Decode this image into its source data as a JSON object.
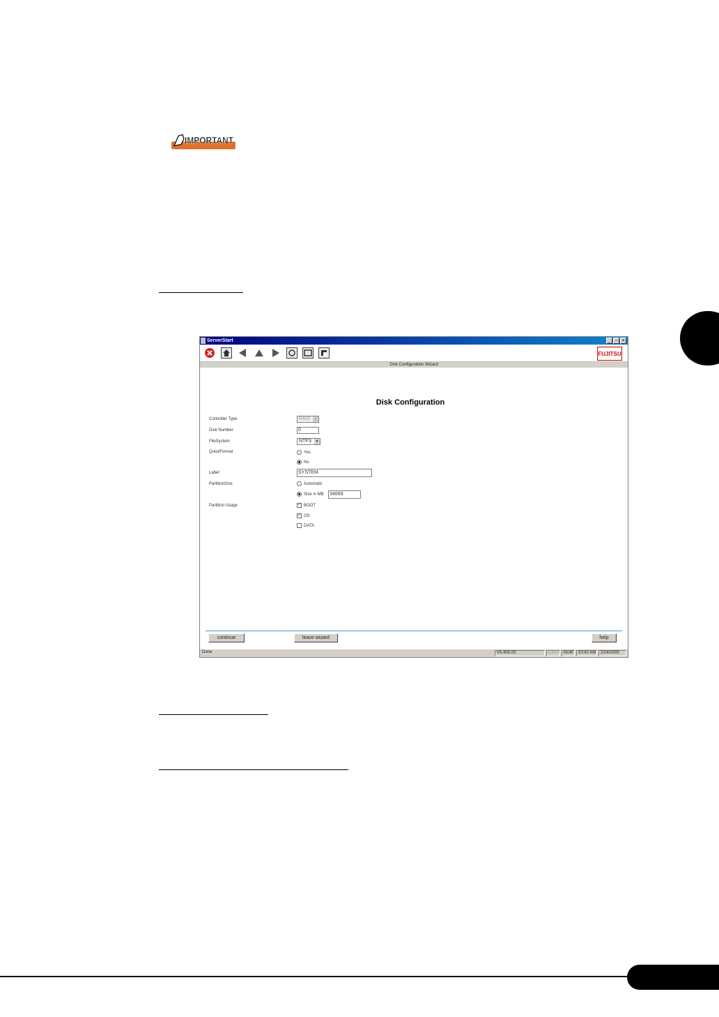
{
  "badge": {
    "text": "IMPORTANT"
  },
  "window": {
    "title": "ServerStart",
    "controls": {
      "minimize": "_",
      "maximize": "▫",
      "close": "×"
    },
    "logo": "FUJITSU",
    "wizard_bar": "Disk Configuration Wizard",
    "heading": "Disk Configuration",
    "form": {
      "controller_type": {
        "label": "Controller Type",
        "value": "RAID"
      },
      "disk_number": {
        "label": "Disk Number",
        "value": "0"
      },
      "file_system": {
        "label": "FileSystem",
        "value": "NTFS"
      },
      "quick_format": {
        "label": "QuickFormat",
        "yes": "Yes",
        "no": "No"
      },
      "label": {
        "label": "Label",
        "value": "SYSTEM"
      },
      "partition_size": {
        "label": "PartitionSize",
        "automatic": "Automatic",
        "size_in_mb": "Size in MB",
        "size_value": "34669"
      },
      "partition_usage": {
        "label": "Partition Usage",
        "boot": "BOOT",
        "os": "OS",
        "data": "DATA"
      }
    },
    "buttons": {
      "continue": "continue",
      "leave_wizard": "leave wizard",
      "help": "help"
    },
    "statusbar": {
      "status": "Done",
      "version": "V5.405.03",
      "caps": "CAPS",
      "num": "NUM",
      "time": "10:42 AM",
      "date": "2/24/2005"
    }
  }
}
